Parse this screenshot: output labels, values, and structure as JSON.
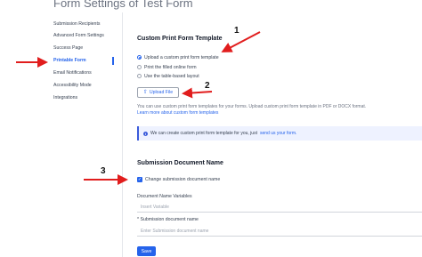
{
  "page": {
    "title": "Form Settings of Test Form"
  },
  "sidebar": {
    "items": [
      {
        "label": "Submission Recipients"
      },
      {
        "label": "Advanced Form Settings"
      },
      {
        "label": "Success Page"
      },
      {
        "label": "Printable Form",
        "active": true
      },
      {
        "label": "Email Notifications"
      },
      {
        "label": "Accessibility Mode"
      },
      {
        "label": "Integrations"
      }
    ]
  },
  "print_template": {
    "title": "Custom Print Form Template",
    "options": [
      {
        "label": "Upload a custom print form template",
        "selected": true
      },
      {
        "label": "Print the filled online form",
        "selected": false
      },
      {
        "label": "Use the table-based layout",
        "selected": false
      }
    ],
    "upload_button": "Upload File",
    "help_text": "You can use custom print form templates for your forms. Upload custom print form template in PDF or DOCX format.",
    "help_link": "Learn more about custom form templates",
    "info_text": "We can create custom print form template for you, just",
    "info_link": "send us your form."
  },
  "submission_document": {
    "title": "Submission Document Name",
    "checkbox_label": "Change submission document name",
    "checkbox_checked": true,
    "variables_label": "Document Name Variables",
    "variables_placeholder": "Insert Variable",
    "name_label": "Submission document name",
    "name_required_marker": "*",
    "name_placeholder": "Enter Submission document name"
  },
  "actions": {
    "save_label": "Save"
  },
  "annotations": {
    "numbers": [
      "1",
      "2",
      "3"
    ],
    "color": "#e11d1d"
  },
  "colors": {
    "accent": "#2563eb",
    "annotation": "#e11d1d"
  }
}
